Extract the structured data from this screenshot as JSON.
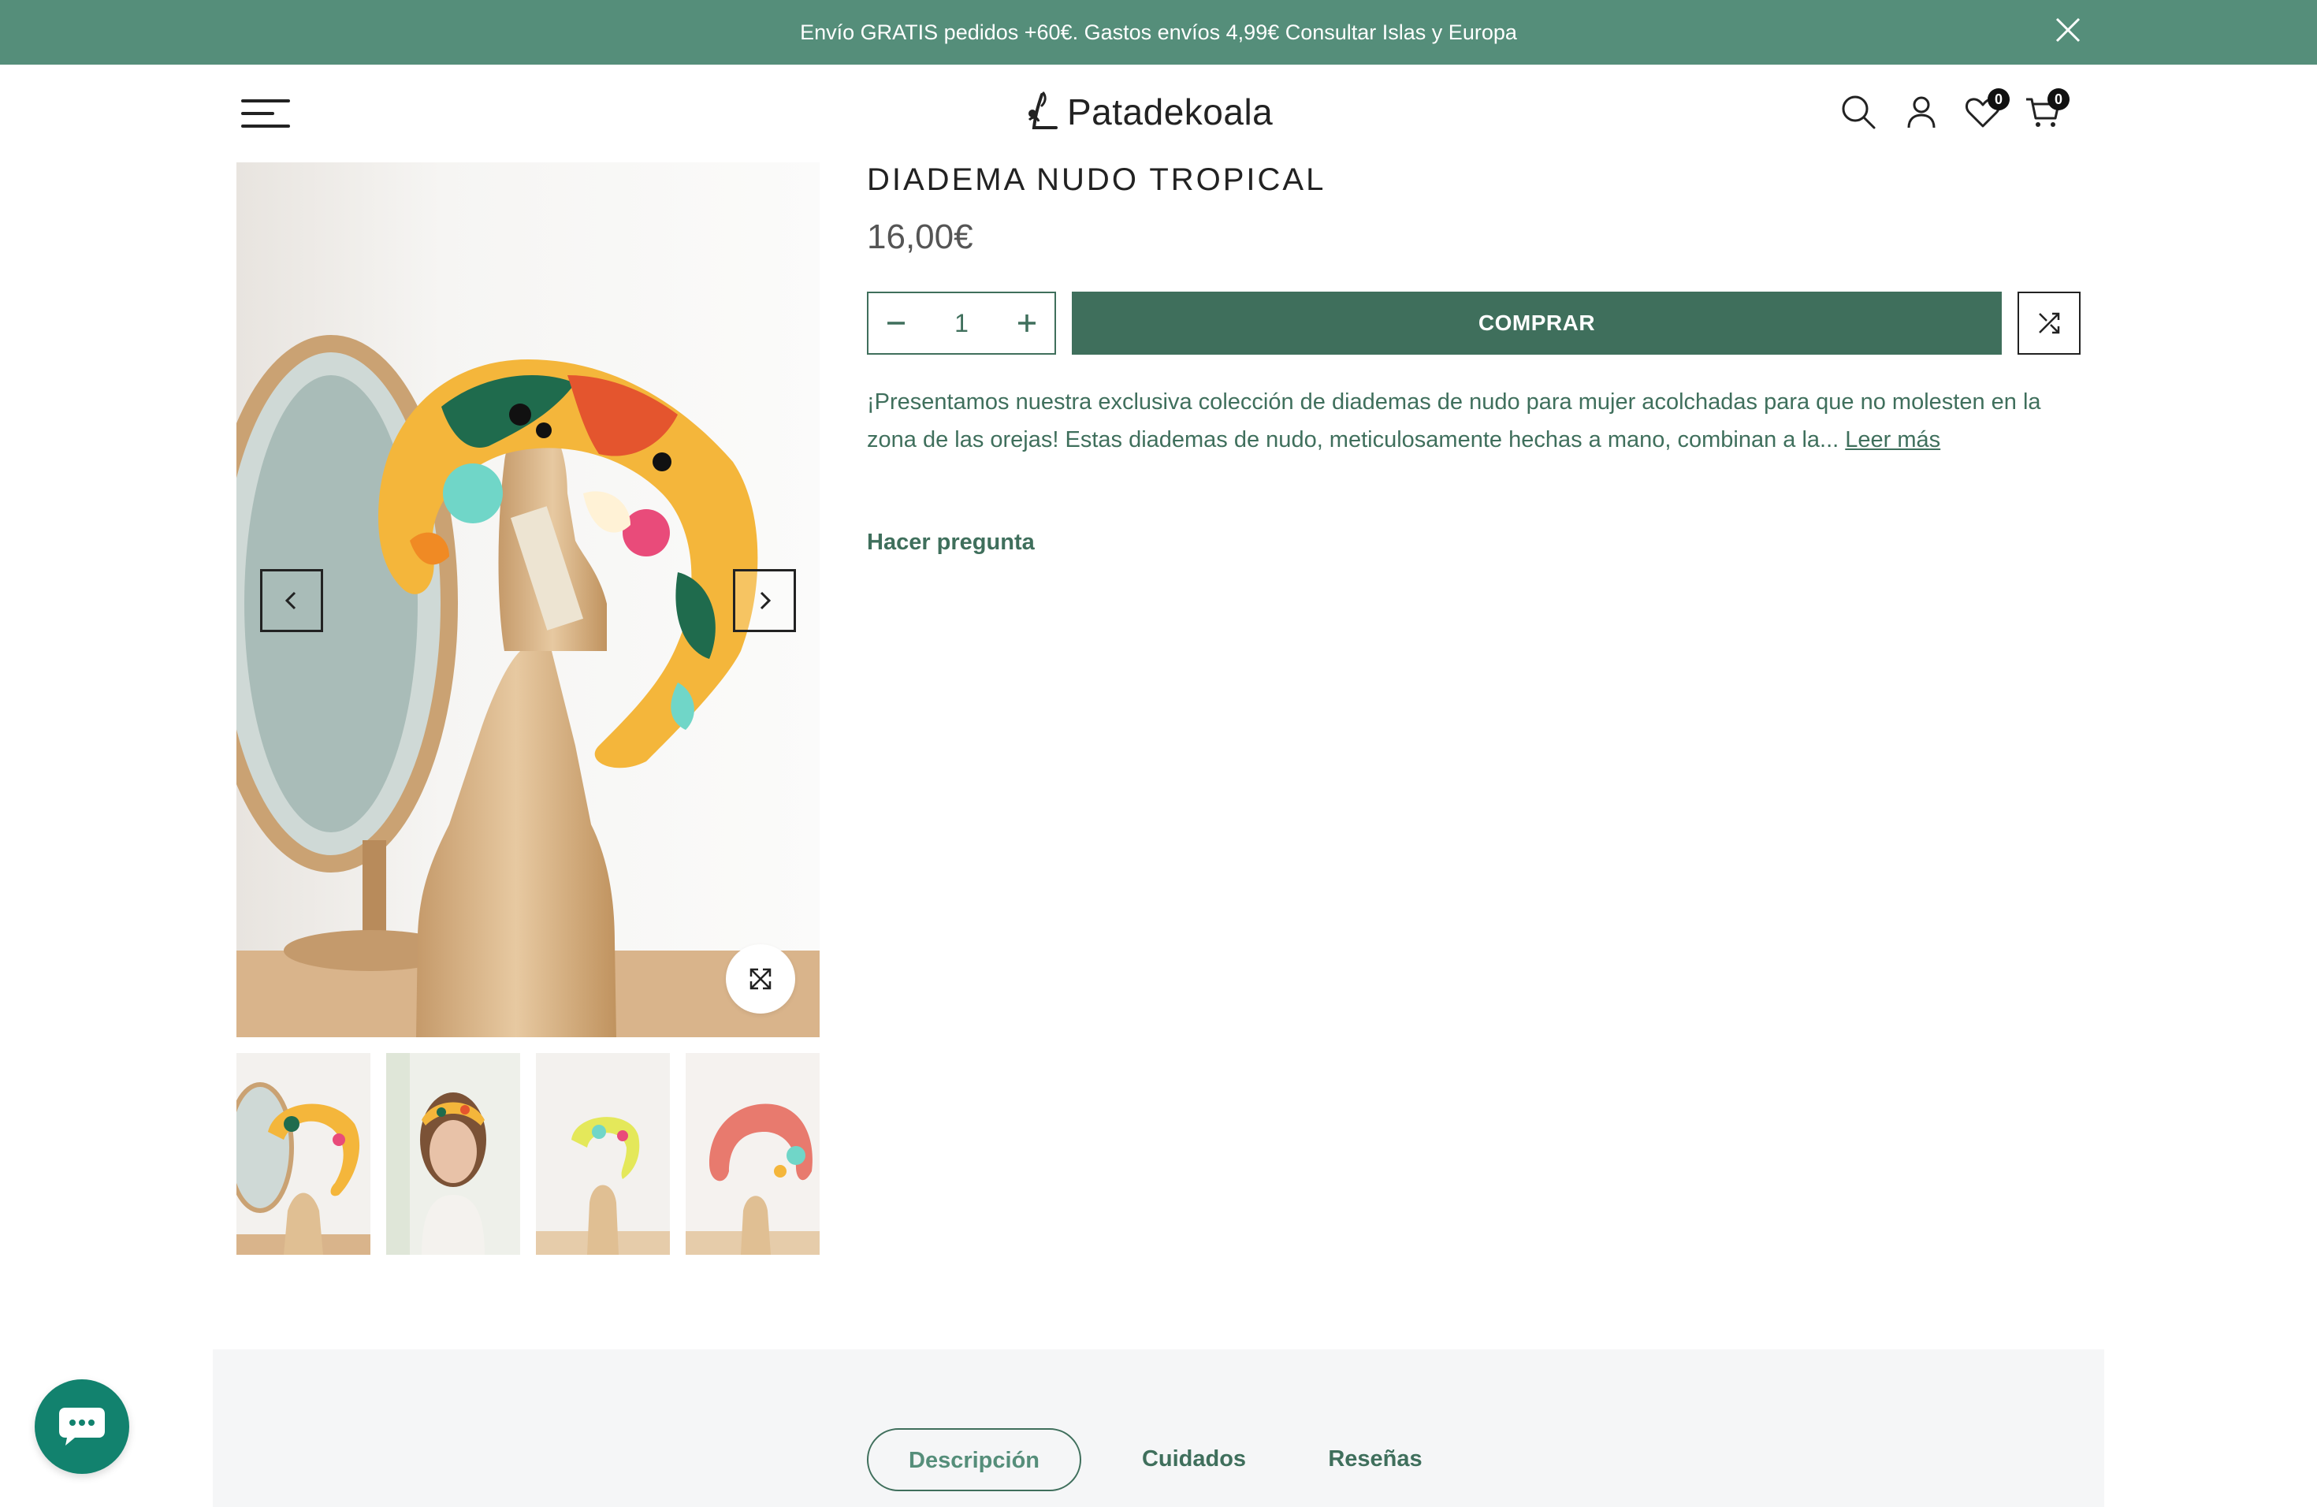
{
  "announcement": {
    "text": "Envío GRATIS pedidos +60€. Gastos envíos 4,99€ Consultar Islas y Europa"
  },
  "header": {
    "logo_text": "Patadekoala",
    "wishlist_count": "0",
    "cart_count": "0",
    "icons": [
      "menu-icon",
      "search-icon",
      "user-icon",
      "heart-icon",
      "cart-icon"
    ]
  },
  "product": {
    "title": "DIADEMA NUDO TROPICAL",
    "price": "16,00€",
    "quantity": "1",
    "buy_label": "COMPRAR",
    "description": "¡Presentamos nuestra exclusiva colección de diademas de nudo para mujer acolchadas para que no molesten en la zona de las orejas! Estas diademas de nudo, meticulosamente hechas a mano, combinan a la...",
    "read_more": "Leer más",
    "ask_question": "Hacer pregunta"
  },
  "tabs": [
    {
      "label": "Descripción",
      "active": true
    },
    {
      "label": "Cuidados",
      "active": false
    },
    {
      "label": "Reseñas",
      "active": false
    }
  ],
  "colors": {
    "announcement_bg": "#558e7a",
    "primary": "#3f6f5c",
    "chat_button": "#12826e",
    "tabs_bg": "#f5f6f7"
  }
}
